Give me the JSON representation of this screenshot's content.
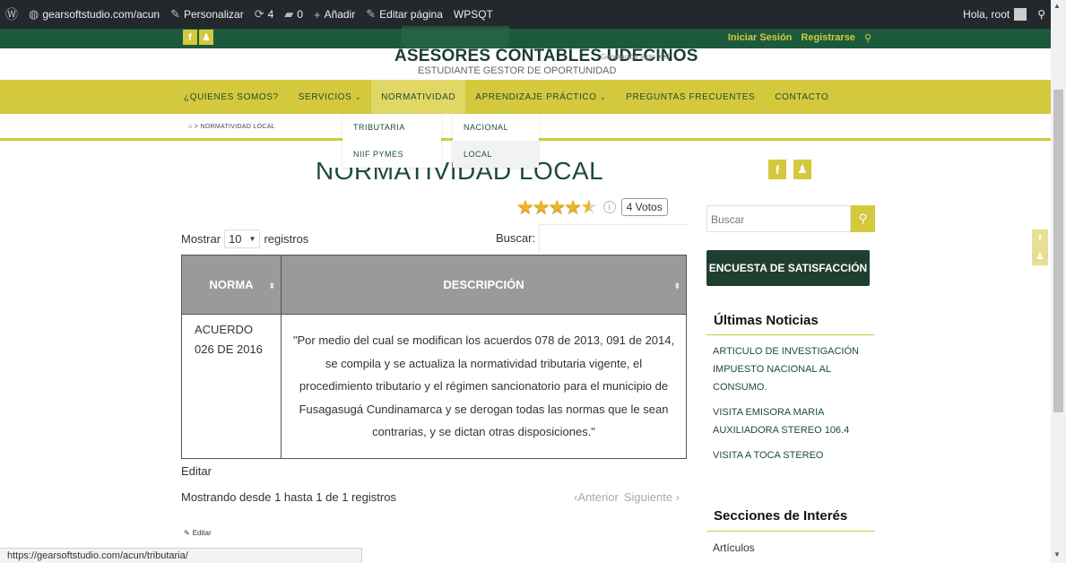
{
  "adminbar": {
    "wp_logo": "wordpress-icon",
    "site_url": "gearsoftstudio.com/acun",
    "customize": "Personalizar",
    "updates": "4",
    "comments": "0",
    "add_new": "Añadir",
    "edit_page": "Editar página",
    "plugin": "WPSQT",
    "greeting": "Hola, root"
  },
  "header": {
    "login": "Iniciar Sesión",
    "register": "Registrarse",
    "brand": "ASESORES CONTABLES UDECINOS",
    "brand_sub": "Generación Siglo XXI",
    "tagline": "ESTUDIANTE GESTOR DE OPORTUNIDAD"
  },
  "nav": {
    "items": [
      "¿QUIENES SOMOS?",
      "SERVICIOS",
      "NORMATIVIDAD",
      "APRENDIZAJE PRÁCTICO",
      "PREGUNTAS FRECUENTES",
      "CONTACTO"
    ]
  },
  "dropdown_normatividad": [
    "TRIBUTARIA",
    "NIIF PYMES"
  ],
  "dropdown_tributaria": [
    "NACIONAL",
    "LOCAL"
  ],
  "breadcrumb": {
    "current": "NORMATIVIDAD LOCAL",
    "separator": ">"
  },
  "page": {
    "title": "NORMATIVIDAD LOCAL",
    "rating": {
      "stars": 4.5,
      "votes": "4 Votos"
    }
  },
  "table_controls": {
    "show_label": "Mostrar",
    "length": "10",
    "records_label": "registros",
    "search_label": "Buscar:"
  },
  "table": {
    "headers": [
      "NORMA",
      "DESCRIPCIÓN"
    ],
    "rows": [
      {
        "norma": "ACUERDO 026 DE 2016",
        "descripcion": "\"Por medio del cual se modifican los acuerdos 078 de 2013, 091 de 2014, se compila y se actualiza la normatividad tributaria vigente, el procedimiento tributario y el régimen sancionatorio para el municipio de Fusagasugá Cundinamarca y se derogan todas las normas que le sean contrarias, y se dictan otras disposiciones.\""
      }
    ]
  },
  "footer": {
    "edit": "Editar",
    "info": "Mostrando desde 1 hasta 1 de 1 registros",
    "prev": "‹Anterior",
    "next": "Siguiente ›",
    "edit_small": "Editar"
  },
  "sidebar": {
    "search_placeholder": "Buscar",
    "survey_button": "ENCUESTA DE SATISFACCIÓN",
    "news_heading": "Últimas Noticias",
    "news": [
      "ARTICULO DE INVESTIGACIÓN IMPUESTO NACIONAL AL CONSUMO.",
      "VISITA EMISORA MARIA AUXILIADORA STEREO 106.4",
      "VISITA A TOCA STEREO"
    ],
    "interest_heading": "Secciones de Interés",
    "interest_first": "Artículos"
  },
  "status_url": "https://gearsoftstudio.com/acun/tributaria/",
  "colors": {
    "brand_green": "#1c5a3e",
    "accent_yellow": "#d4c93d",
    "admin_bar": "#23282d"
  }
}
